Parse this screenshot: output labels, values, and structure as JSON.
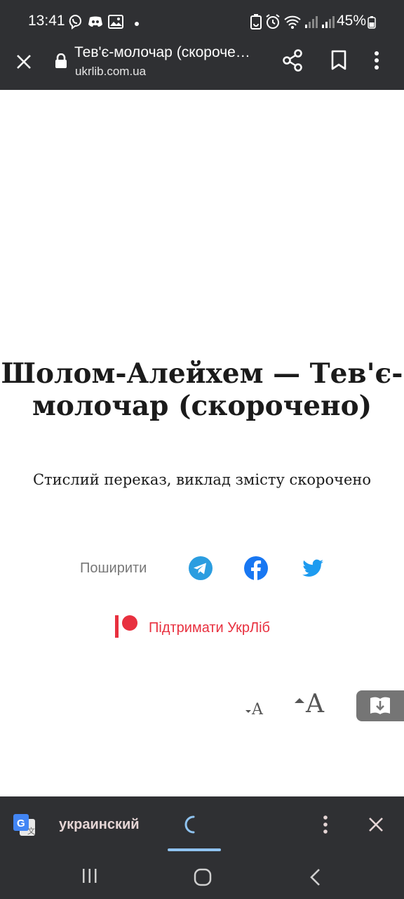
{
  "status": {
    "time": "13:41",
    "battery": "45%"
  },
  "browser": {
    "title": "Тев'є-молочар (скороче…",
    "url": "ukrlib.com.ua"
  },
  "page": {
    "title": "Шолом-Алейхем — Тев'є-молочар (скорочено)",
    "subtitle": "Стислий переказ, виклад змісту скорочено",
    "share_label": "Поширити",
    "support_label": "Підтримати УкрЛіб",
    "font_decrease_label": "A",
    "font_increase_label": "A"
  },
  "translate": {
    "language": "украинский"
  },
  "colors": {
    "bar_bg": "#2f3033",
    "support_red": "#e8303f",
    "telegram": "#2b9de0",
    "facebook": "#1877f2",
    "twitter": "#1d9bf0"
  }
}
